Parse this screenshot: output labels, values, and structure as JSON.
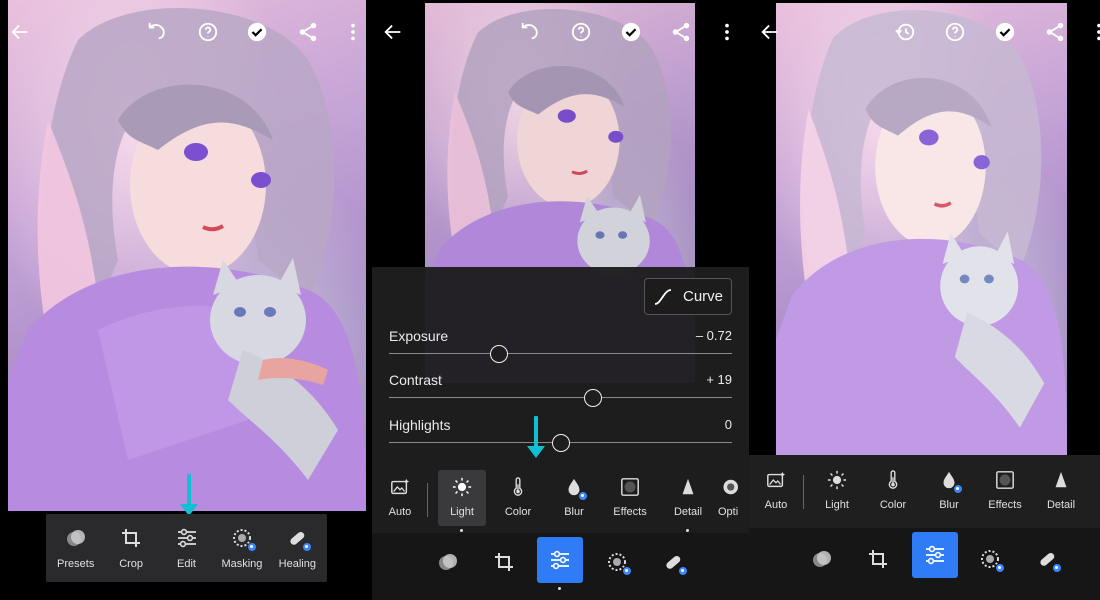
{
  "panel1": {
    "toolbar": [
      {
        "label": "Presets",
        "icon": "presets-icon"
      },
      {
        "label": "Crop",
        "icon": "crop-icon"
      },
      {
        "label": "Edit",
        "icon": "sliders-icon"
      },
      {
        "label": "Masking",
        "icon": "masking-icon"
      },
      {
        "label": "Healing",
        "icon": "healing-icon"
      }
    ]
  },
  "panel2": {
    "curve_label": "Curve",
    "sliders": [
      {
        "name": "Exposure",
        "value": "– 0.72",
        "level": -0.36
      },
      {
        "name": "Contrast",
        "value": "+ 19",
        "level": 0.19
      },
      {
        "name": "Highlights",
        "value": "0",
        "level": 0
      }
    ],
    "categories": [
      {
        "label": "Auto"
      },
      {
        "label": "Light"
      },
      {
        "label": "Color"
      },
      {
        "label": "Blur"
      },
      {
        "label": "Effects"
      },
      {
        "label": "Detail"
      },
      {
        "label": "Opti"
      }
    ],
    "active_category": "Light"
  },
  "panel3": {
    "categories": [
      {
        "label": "Auto"
      },
      {
        "label": "Light"
      },
      {
        "label": "Color"
      },
      {
        "label": "Blur"
      },
      {
        "label": "Effects"
      },
      {
        "label": "Detail"
      }
    ]
  },
  "colors": {
    "accent": "#2f7cf6",
    "arrow": "#11c0d4",
    "panel_bg": "#2a2a2c"
  }
}
